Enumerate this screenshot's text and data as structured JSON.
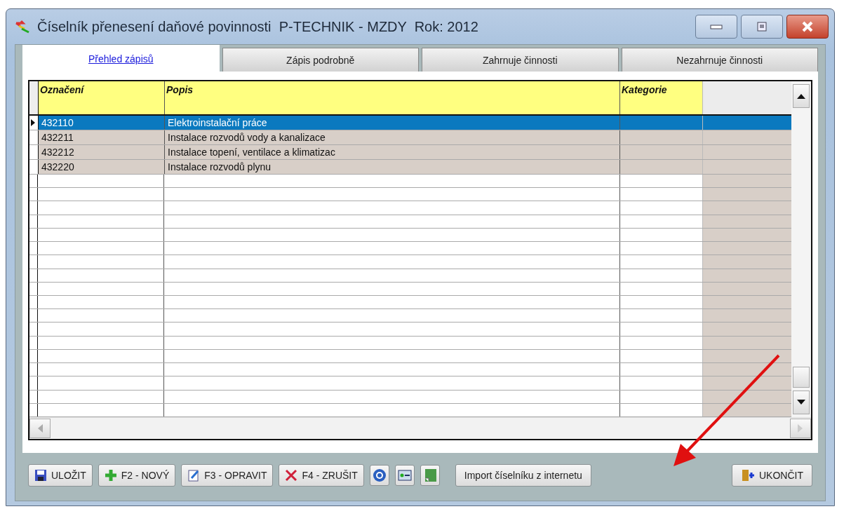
{
  "window": {
    "title": "Číselník přenesení daňové povinnosti  P-TECHNIK - MZDY  Rok: 2012"
  },
  "tabs": [
    {
      "label": "Přehled zápisů",
      "selected": true
    },
    {
      "label": "Zápis podrobně",
      "selected": false
    },
    {
      "label": "Zahrnuje činnosti",
      "selected": false
    },
    {
      "label": "Nezahrnuje činnosti",
      "selected": false
    }
  ],
  "table": {
    "columns": [
      "Označení",
      "Popis",
      "Kategorie"
    ],
    "rows": [
      {
        "code": "432110",
        "description": "Elektroinstalační práce",
        "selected": true
      },
      {
        "code": "432211",
        "description": "Instalace rozvodů vody a kanalizace",
        "selected": false
      },
      {
        "code": "432212",
        "description": "Instalace topení, ventilace a klimatizac",
        "selected": false
      },
      {
        "code": "432220",
        "description": "Instalace rozvodů plynu",
        "selected": false
      }
    ]
  },
  "buttons": [
    {
      "label": "ULOŽIT"
    },
    {
      "label": "F2 - NOVÝ"
    },
    {
      "label": "F3 - OPRAVIT"
    },
    {
      "label": "F4 - ZRUŠIT"
    }
  ],
  "import_button": {
    "label": "Import číselníku z internetu"
  },
  "exit_button": {
    "label": "UKONČIT"
  }
}
